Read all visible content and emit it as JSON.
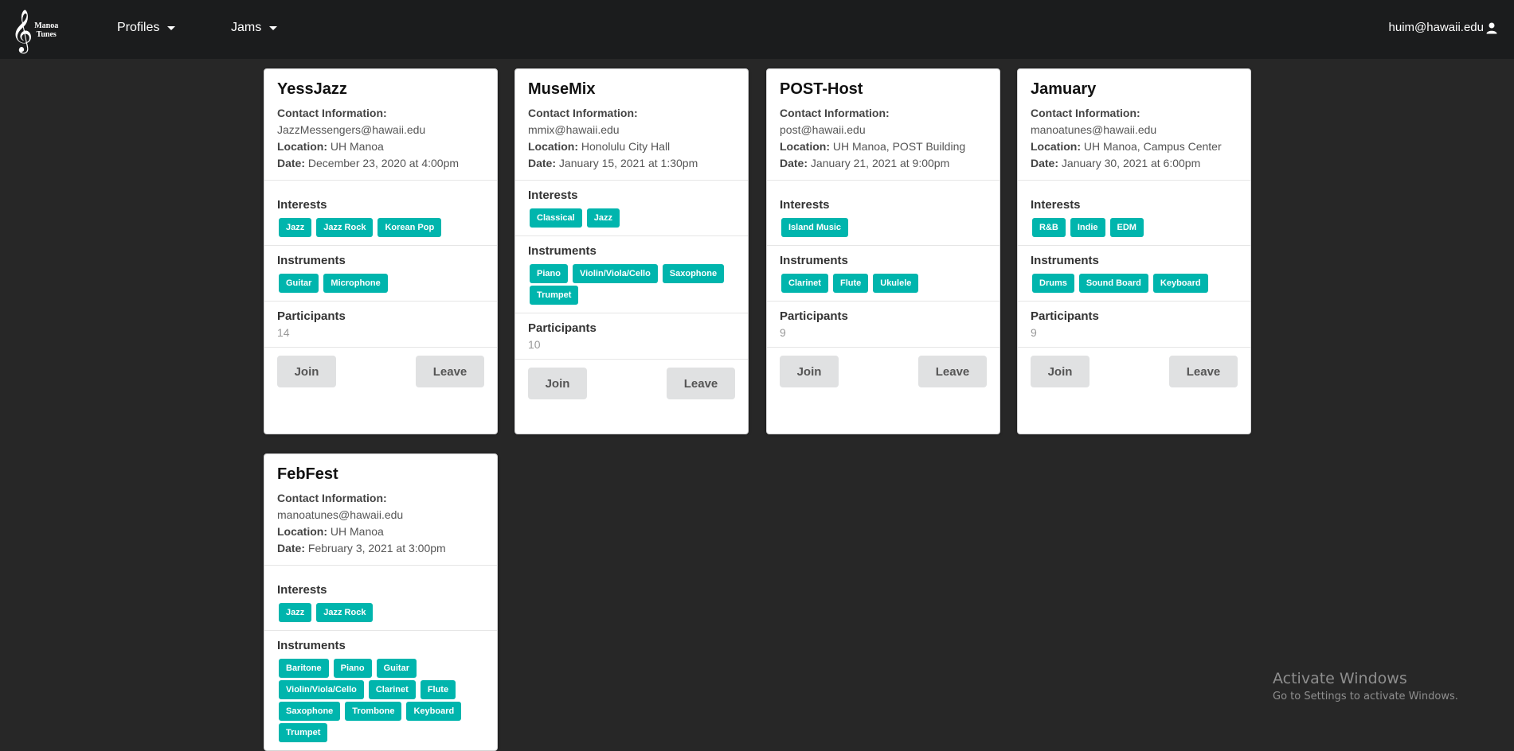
{
  "brand": {
    "line1": "Manoa",
    "line2": "Tunes"
  },
  "nav": {
    "profiles": "Profiles",
    "jams": "Jams",
    "user": "huim@hawaii.edu"
  },
  "labels": {
    "contact": "Contact Information:",
    "location": "Location:",
    "date": "Date:",
    "interests": "Interests",
    "instruments": "Instruments",
    "participants": "Participants",
    "join": "Join",
    "leave": "Leave"
  },
  "jams": [
    {
      "name": "YessJazz",
      "contact": "JazzMessengers@hawaii.edu",
      "location": "UH Manoa",
      "date": "December 23, 2020 at 4:00pm",
      "interests": [
        "Jazz",
        "Jazz Rock",
        "Korean Pop"
      ],
      "instruments": [
        "Guitar",
        "Microphone"
      ],
      "participants": "14"
    },
    {
      "name": "MuseMix",
      "contact": "mmix@hawaii.edu",
      "location": "Honolulu City Hall",
      "date": "January 15, 2021 at 1:30pm",
      "interests": [
        "Classical",
        "Jazz"
      ],
      "instruments": [
        "Piano",
        "Violin/Viola/Cello",
        "Saxophone",
        "Trumpet"
      ],
      "participants": "10"
    },
    {
      "name": "POST-Host",
      "contact": "post@hawaii.edu",
      "location": "UH Manoa, POST Building",
      "date": "January 21, 2021 at 9:00pm",
      "interests": [
        "Island Music"
      ],
      "instruments": [
        "Clarinet",
        "Flute",
        "Ukulele"
      ],
      "participants": "9"
    },
    {
      "name": "Jamuary",
      "contact": "manoatunes@hawaii.edu",
      "location": "UH Manoa, Campus Center",
      "date": "January 30, 2021 at 6:00pm",
      "interests": [
        "R&B",
        "Indie",
        "EDM"
      ],
      "instruments": [
        "Drums",
        "Sound Board",
        "Keyboard"
      ],
      "participants": "9"
    },
    {
      "name": "FebFest",
      "contact": "manoatunes@hawaii.edu",
      "location": "UH Manoa",
      "date": "February 3, 2021 at 3:00pm",
      "interests": [
        "Jazz",
        "Jazz Rock"
      ],
      "instruments": [
        "Baritone",
        "Piano",
        "Guitar",
        "Violin/Viola/Cello",
        "Clarinet",
        "Flute",
        "Saxophone",
        "Trombone",
        "Keyboard",
        "Trumpet"
      ],
      "participants": ""
    }
  ],
  "watermark": {
    "line1": "Activate Windows",
    "line2": "Go to Settings to activate Windows."
  },
  "colors": {
    "accent": "#00b5ad",
    "navbar": "#1b1c1d",
    "background": "#272727"
  }
}
